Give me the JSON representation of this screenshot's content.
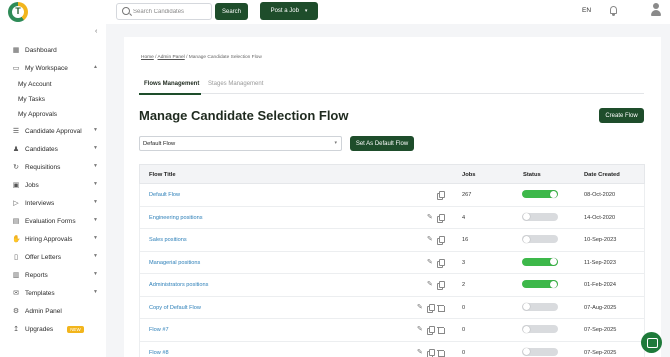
{
  "header": {
    "logo_letter": "T",
    "search_placeholder": "Search Candidates",
    "search_button": "Search",
    "post_job_button": "Post a Job",
    "language": "EN",
    "bell_icon": "bell-icon",
    "user_icon": "user-avatar-icon"
  },
  "sidebar": {
    "items": [
      {
        "label": "Dashboard",
        "icon": "grid-icon",
        "has_caret": false
      },
      {
        "label": "My Workspace",
        "icon": "monitor-icon",
        "has_caret": true,
        "expanded": true
      },
      {
        "label": "Candidate Approval",
        "icon": "checklist-icon",
        "has_caret": true
      },
      {
        "label": "Candidates",
        "icon": "people-icon",
        "has_caret": true
      },
      {
        "label": "Requisitions",
        "icon": "refresh-icon",
        "has_caret": true
      },
      {
        "label": "Jobs",
        "icon": "briefcase-icon",
        "has_caret": true
      },
      {
        "label": "Interviews",
        "icon": "video-icon",
        "has_caret": true
      },
      {
        "label": "Evaluation Forms",
        "icon": "form-icon",
        "has_caret": true
      },
      {
        "label": "Hiring Approvals",
        "icon": "handshake-icon",
        "has_caret": true
      },
      {
        "label": "Offer Letters",
        "icon": "document-icon",
        "has_caret": true
      },
      {
        "label": "Reports",
        "icon": "chart-icon",
        "has_caret": true
      },
      {
        "label": "Templates",
        "icon": "mail-icon",
        "has_caret": true
      },
      {
        "label": "Admin Panel",
        "icon": "gear-icon",
        "has_caret": false
      },
      {
        "label": "Upgrades",
        "icon": "upgrade-icon",
        "has_caret": false,
        "badge": "NEW"
      }
    ],
    "workspace_sub": [
      "My Account",
      "My Tasks",
      "My Approvals"
    ]
  },
  "breadcrumb": {
    "home": "Home",
    "admin": "Admin Panel",
    "current": "/ Manage Candidate Selection Flow"
  },
  "tabs": [
    {
      "label": "Flows Management",
      "active": true
    },
    {
      "label": "Stages Management",
      "active": false
    }
  ],
  "page_title": "Manage Candidate Selection Flow",
  "create_flow_button": "Create Flow",
  "flow_select_value": "Default Flow",
  "set_default_button": "Set As Default Flow",
  "table": {
    "headers": {
      "title": "Flow Title",
      "jobs": "Jobs",
      "status": "Status",
      "date": "Date Created"
    },
    "rows": [
      {
        "title": "Default Flow",
        "jobs": "267",
        "status": true,
        "date": "08-Oct-2020",
        "actions": [
          "copy"
        ]
      },
      {
        "title": "Engineering positions",
        "jobs": "4",
        "status": false,
        "date": "14-Oct-2020",
        "actions": [
          "edit",
          "copy"
        ]
      },
      {
        "title": "Sales positions",
        "jobs": "16",
        "status": false,
        "date": "10-Sep-2023",
        "actions": [
          "edit",
          "copy"
        ]
      },
      {
        "title": "Managerial positions",
        "jobs": "3",
        "status": true,
        "date": "11-Sep-2023",
        "actions": [
          "edit",
          "copy"
        ]
      },
      {
        "title": "Administrators positions",
        "jobs": "2",
        "status": true,
        "date": "01-Feb-2024",
        "actions": [
          "edit",
          "copy"
        ]
      },
      {
        "title": "Copy of Default Flow",
        "jobs": "0",
        "status": false,
        "date": "07-Aug-2025",
        "actions": [
          "edit",
          "copy",
          "delete"
        ]
      },
      {
        "title": "Flow #7",
        "jobs": "0",
        "status": false,
        "date": "07-Sep-2025",
        "actions": [
          "edit",
          "copy",
          "delete"
        ]
      },
      {
        "title": "Flow #8",
        "jobs": "0",
        "status": false,
        "date": "07-Sep-2025",
        "actions": [
          "edit",
          "copy",
          "delete"
        ]
      }
    ]
  },
  "colors": {
    "brand_dark": "#1e4d2b",
    "toggle_on": "#3db84a",
    "link": "#2c7fb8"
  }
}
